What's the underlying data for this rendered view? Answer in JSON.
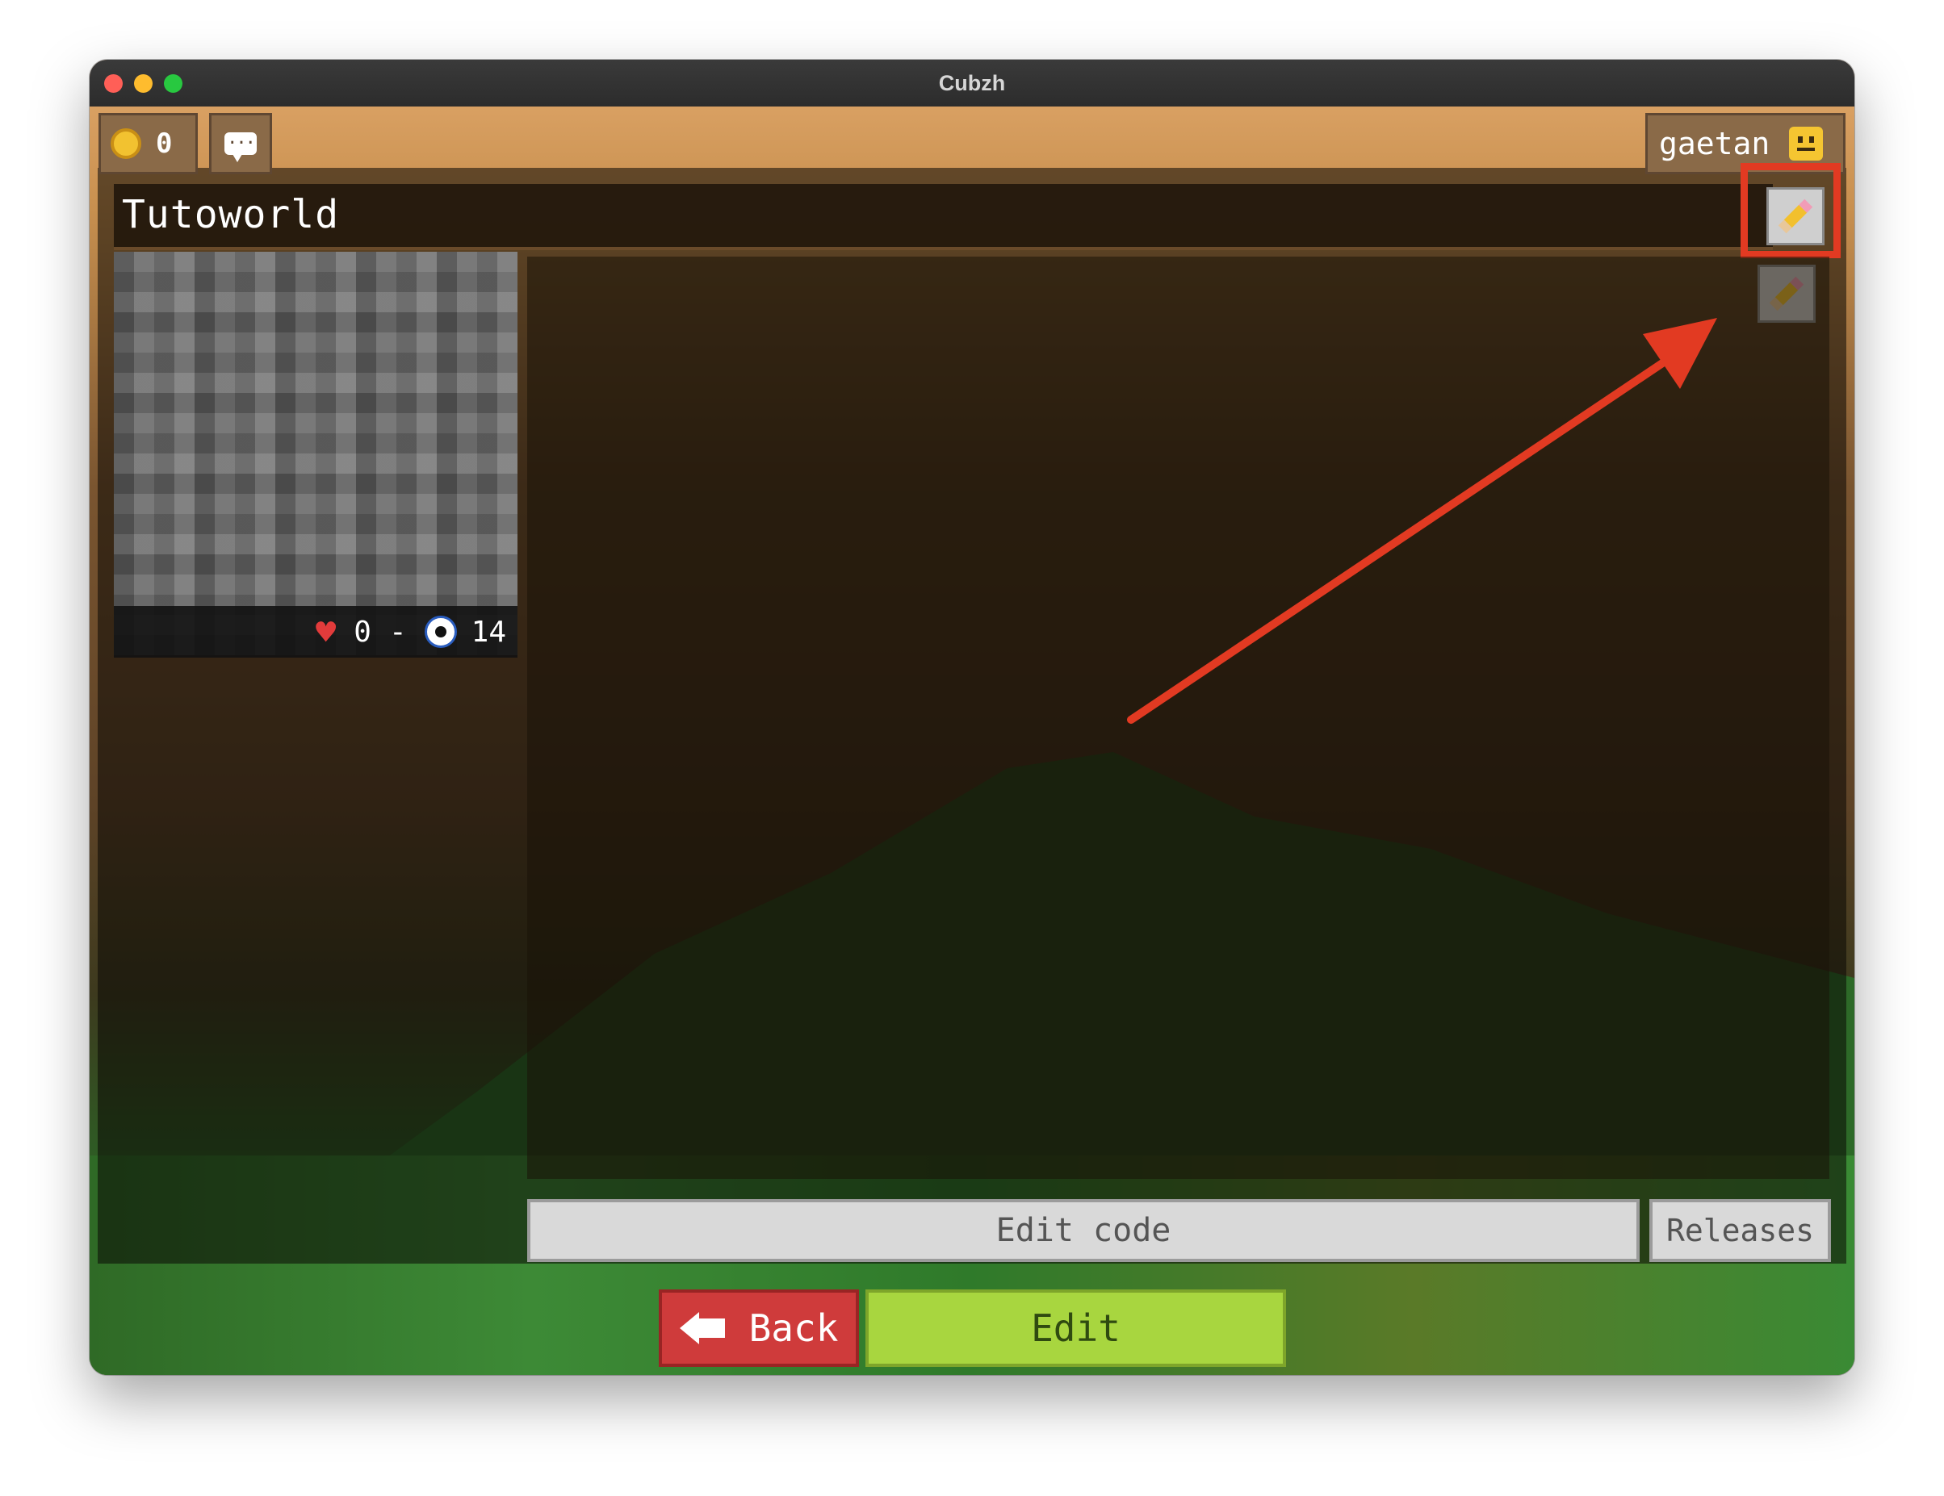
{
  "window": {
    "title": "Cubzh"
  },
  "topbar": {
    "coins": "0",
    "username": "gaetan",
    "icons": {
      "coin": "coin-icon",
      "chat": "chat-bubble-icon",
      "avatar": "smiley-avatar-icon"
    },
    "chat_glyph": "···"
  },
  "world": {
    "title": "Tutoworld",
    "likes": "0",
    "separator": "-",
    "views": "14",
    "heart_glyph": "♥"
  },
  "actions": {
    "edit_code": "Edit code",
    "releases": "Releases",
    "back": "Back",
    "edit": "Edit"
  },
  "annotation": {
    "color": "#e23a22"
  },
  "colors": {
    "back_button": "#cf3b3b",
    "edit_button": "#a8d63f",
    "panel": "#8a6a48"
  }
}
